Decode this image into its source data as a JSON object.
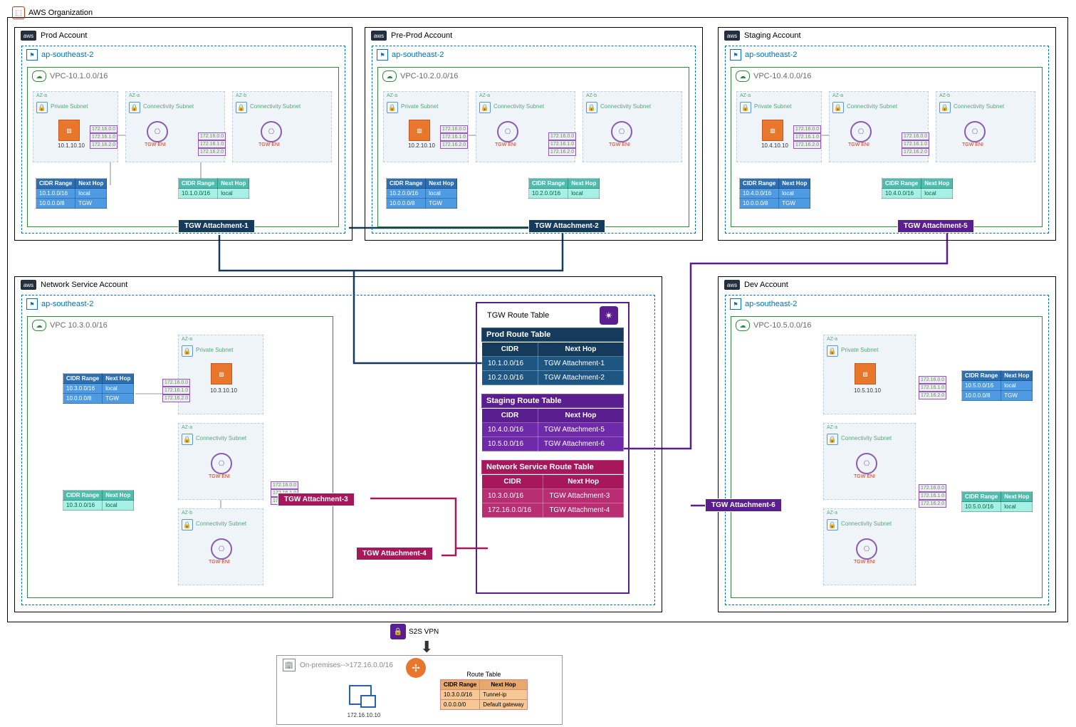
{
  "org": "AWS Organization",
  "accounts": {
    "prod": {
      "name": "Prod Account",
      "region": "ap-southeast-2",
      "vpc": "VPC-10.1.0.0/16",
      "priv_subnet": "Private Subnet",
      "conn_subnet": "Connectivity Subnet",
      "az_a": "AZ-a",
      "az_b": "AZ-b",
      "ec2_ip": "10.1.10.10",
      "eni": "TGW ENI",
      "private_rt": {
        "head": [
          "CIDR Range",
          "Next Hop"
        ],
        "rows": [
          [
            "10.1.0.0/16",
            "local"
          ],
          [
            "10.0.0.0/8",
            "TGW"
          ]
        ]
      },
      "conn_rt": {
        "head": [
          "CIDR Range",
          "Next Hop"
        ],
        "rows": [
          [
            "10.1.0.0/16",
            "local"
          ]
        ]
      },
      "attach": "TGW Attachment-1",
      "chips": [
        "172.16.0.0",
        "172.16.1.0",
        "172.16.2.0"
      ]
    },
    "preprod": {
      "name": "Pre-Prod Account",
      "region": "ap-southeast-2",
      "vpc": "VPC-10.2.0.0/16",
      "priv_subnet": "Private Subnet",
      "conn_subnet": "Connectivity Subnet",
      "az_a": "AZ-a",
      "az_b": "AZ-b",
      "ec2_ip": "10.2.10.10",
      "eni": "TGW ENI",
      "private_rt": {
        "head": [
          "CIDR Range",
          "Next Hop"
        ],
        "rows": [
          [
            "10.2.0.0/16",
            "local"
          ],
          [
            "10.0.0.0/8",
            "TGW"
          ]
        ]
      },
      "conn_rt": {
        "head": [
          "CIDR Range",
          "Next Hop"
        ],
        "rows": [
          [
            "10.2.0.0/16",
            "local"
          ]
        ]
      },
      "attach": "TGW Attachment-2",
      "chips": [
        "172.16.0.0",
        "172.16.1.0",
        "172.16.2.0"
      ]
    },
    "staging": {
      "name": "Staging Account",
      "region": "ap-southeast-2",
      "vpc": "VPC-10.4.0.0/16",
      "priv_subnet": "Private Subnet",
      "conn_subnet": "Connectivity Subnet",
      "az_a": "AZ-a",
      "az_b": "AZ-b",
      "ec2_ip": "10.4.10.10",
      "eni": "TGW ENI",
      "private_rt": {
        "head": [
          "CIDR Range",
          "Next Hop"
        ],
        "rows": [
          [
            "10.4.0.0/16",
            "local"
          ],
          [
            "10.0.0.0/8",
            "TGW"
          ]
        ]
      },
      "conn_rt": {
        "head": [
          "CIDR Range",
          "Next Hop"
        ],
        "rows": [
          [
            "10.4.0.0/16",
            "local"
          ]
        ]
      },
      "attach": "TGW Attachment-5",
      "chips": [
        "172.16.0.0",
        "172.16.1.0",
        "172.16.2.0"
      ]
    },
    "netsvc": {
      "name": "Network Service Account",
      "region": "ap-southeast-2",
      "vpc": "VPC 10.3.0.0/16",
      "priv_subnet": "Private Subnet",
      "conn_subnet": "Connectivity Subnet",
      "az_a": "AZ-a",
      "az_b": "AZ-b",
      "ec2_ip": "10.3.10.10",
      "eni": "TGW ENI",
      "private_rt": {
        "head": [
          "CIDR Range",
          "Next Hop"
        ],
        "rows": [
          [
            "10.3.0.0/16",
            "local"
          ],
          [
            "10.0.0.0/8",
            "TGW"
          ]
        ]
      },
      "conn_rt": {
        "head": [
          "CIDR Range",
          "Next Hop"
        ],
        "rows": [
          [
            "10.3.0.0/16",
            "local"
          ]
        ]
      },
      "attach3": "TGW Attachment-3",
      "attach4": "TGW Attachment-4",
      "chips": [
        "172.16.0.0",
        "172.16.1.0",
        "172.16.2.0"
      ]
    },
    "dev": {
      "name": "Dev Account",
      "region": "ap-southeast-2",
      "vpc": "VPC-10.5.0.0/16",
      "priv_subnet": "Private Subnet",
      "conn_subnet": "Connectivity Subnet",
      "az_a": "AZ-a",
      "ec2_ip": "10.5.10.10",
      "eni": "TGW ENI",
      "private_rt": {
        "head": [
          "CIDR Range",
          "Next Hop"
        ],
        "rows": [
          [
            "10.5.0.0/16",
            "local"
          ],
          [
            "10.0.0.0/8",
            "TGW"
          ]
        ]
      },
      "conn_rt": {
        "head": [
          "CIDR Range",
          "Next Hop"
        ],
        "rows": [
          [
            "10.5.0.0/16",
            "local"
          ]
        ]
      },
      "attach": "TGW Attachment-6",
      "chips": [
        "172.16.0.0",
        "172.16.1.0",
        "172.16.2.0"
      ]
    }
  },
  "tgw": {
    "title": "TGW Route Table",
    "prod": {
      "title": "Prod Route Table",
      "head": [
        "CIDR",
        "Next Hop"
      ],
      "rows": [
        [
          "10.1.0.0/16",
          "TGW Attachment-1"
        ],
        [
          "10.2.0.0/16",
          "TGW Attachment-2"
        ]
      ]
    },
    "staging": {
      "title": "Staging Route Table",
      "head": [
        "CIDR",
        "Next Hop"
      ],
      "rows": [
        [
          "10.4.0.0/16",
          "TGW Attachment-5"
        ],
        [
          "10.5.0.0/16",
          "TGW Attachment-6"
        ]
      ]
    },
    "netsvc": {
      "title": "Network Service Route Table",
      "head": [
        "CIDR",
        "Next Hop"
      ],
      "rows": [
        [
          "10.3.0.0/16",
          "TGW Attachment-3"
        ],
        [
          "172.16.0.0/16",
          "TGW Attachment-4"
        ]
      ]
    }
  },
  "s2s": "S2S VPN",
  "onprem": {
    "title": "On-premises-->172.16.0.0/16",
    "host": "172.16.10.10",
    "rt": {
      "title": "Route Table",
      "head": [
        "CIDR Range",
        "Next Hop"
      ],
      "rows": [
        [
          "10.3.0.0/16",
          "Tunnel-ip"
        ],
        [
          "0.0.0.0/0",
          "Default gateway"
        ]
      ]
    }
  }
}
